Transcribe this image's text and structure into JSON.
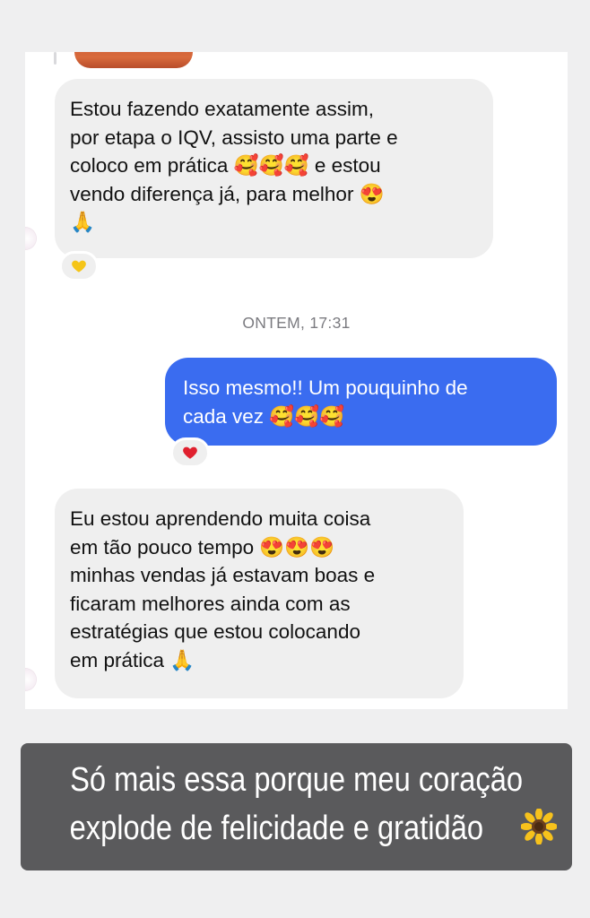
{
  "messages": [
    {
      "direction": "incoming",
      "lines": [
        "Estou fazendo exatamente assim,",
        "por etapa o IQV, assisto uma parte e",
        "coloco em prática 🥰🥰🥰 e estou",
        "vendo diferença já, para melhor 😍",
        "🙏"
      ],
      "reaction": "yellow-heart"
    },
    {
      "direction": "outgoing",
      "lines": [
        "Isso mesmo!! Um pouquinho de",
        "cada vez 🥰🥰🥰"
      ],
      "reaction": "red-heart"
    },
    {
      "direction": "incoming",
      "lines": [
        "Eu estou aprendendo muita coisa",
        "em tão pouco tempo 😍😍😍",
        "minhas vendas já estavam boas e",
        "ficaram melhores ainda com as",
        "estratégias que estou colocando",
        "em prática 🙏"
      ]
    }
  ],
  "timestamp": "ONTEM, 17:31",
  "caption": {
    "line1": "Só mais essa porque meu coração",
    "line2": "explode de felicidade e gratidão",
    "emoji": "🌻"
  },
  "colors": {
    "outgoing_bubble": "#3a6cf0",
    "incoming_bubble": "#efefef",
    "caption_background": "#5a5a5c",
    "yellow_heart": "#f5c518",
    "red_heart": "#e0202e"
  }
}
